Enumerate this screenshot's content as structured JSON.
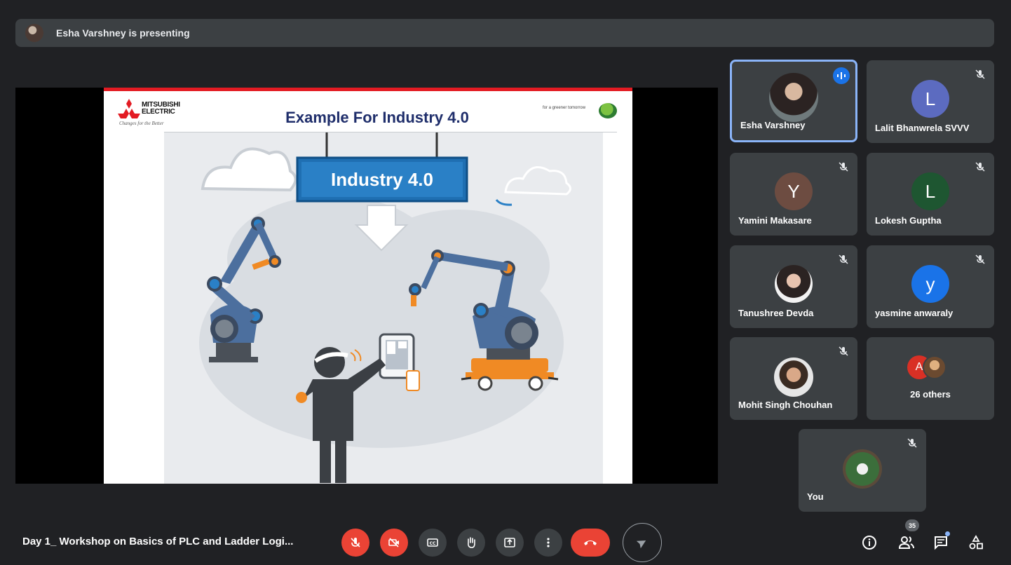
{
  "presenting_banner": {
    "text": "Esha Varshney is presenting"
  },
  "slide": {
    "logo_text_line1": "MITSUBISHI",
    "logo_text_line2": "ELECTRIC",
    "logo_tagline": "Changes for the Better",
    "title": "Example For Industry 4.0",
    "greener_tagline": "for a greener tomorrow",
    "banner_label": "Industry 4.0"
  },
  "participants": [
    {
      "name": "Esha Varshney",
      "avatar_type": "photo",
      "speaking": true,
      "muted": false,
      "active": true
    },
    {
      "name": "Lalit Bhanwrela SVVV",
      "avatar_type": "initial",
      "initial": "L",
      "avatar_color": "#5c6bc0",
      "muted": true
    },
    {
      "name": "Yamini Makasare",
      "avatar_type": "initial",
      "initial": "Y",
      "avatar_color": "#6d4c41",
      "muted": true
    },
    {
      "name": "Lokesh Guptha",
      "avatar_type": "initial",
      "initial": "L",
      "avatar_color": "#1e5631",
      "muted": true
    },
    {
      "name": "Tanushree Devda",
      "avatar_type": "photo",
      "muted": true
    },
    {
      "name": "yasmine anwaraly",
      "avatar_type": "initial",
      "initial": "y",
      "avatar_color": "#1a73e8",
      "muted": true
    },
    {
      "name": "Mohit Singh Chouhan",
      "avatar_type": "photo",
      "muted": true
    },
    {
      "name": "26 others",
      "avatar_type": "group",
      "initial": "A",
      "avatar_color": "#d93025",
      "muted": false
    },
    {
      "name": "You",
      "avatar_type": "photo",
      "muted": true
    }
  ],
  "bottom_bar": {
    "meeting_title": "Day 1_ Workshop on Basics of PLC and Ladder Logi...",
    "controls": [
      {
        "name": "mic-off-button",
        "icon": "mic-off-icon",
        "color": "#ea4335"
      },
      {
        "name": "camera-off-button",
        "icon": "camera-off-icon",
        "color": "#ea4335"
      },
      {
        "name": "captions-button",
        "icon": "captions-icon",
        "color": "#3c4043"
      },
      {
        "name": "raise-hand-button",
        "icon": "hand-icon",
        "color": "#3c4043"
      },
      {
        "name": "present-button",
        "icon": "present-icon",
        "color": "#3c4043"
      },
      {
        "name": "more-options-button",
        "icon": "more-vert-icon",
        "color": "#3c4043"
      },
      {
        "name": "hangup-button",
        "icon": "phone-hangup-icon",
        "color": "#ea4335"
      },
      {
        "name": "send-button",
        "icon": "send-icon",
        "color": "transparent"
      }
    ],
    "right_icons": [
      "info-icon",
      "people-icon",
      "chat-icon",
      "activities-icon"
    ],
    "participant_count": "35"
  }
}
